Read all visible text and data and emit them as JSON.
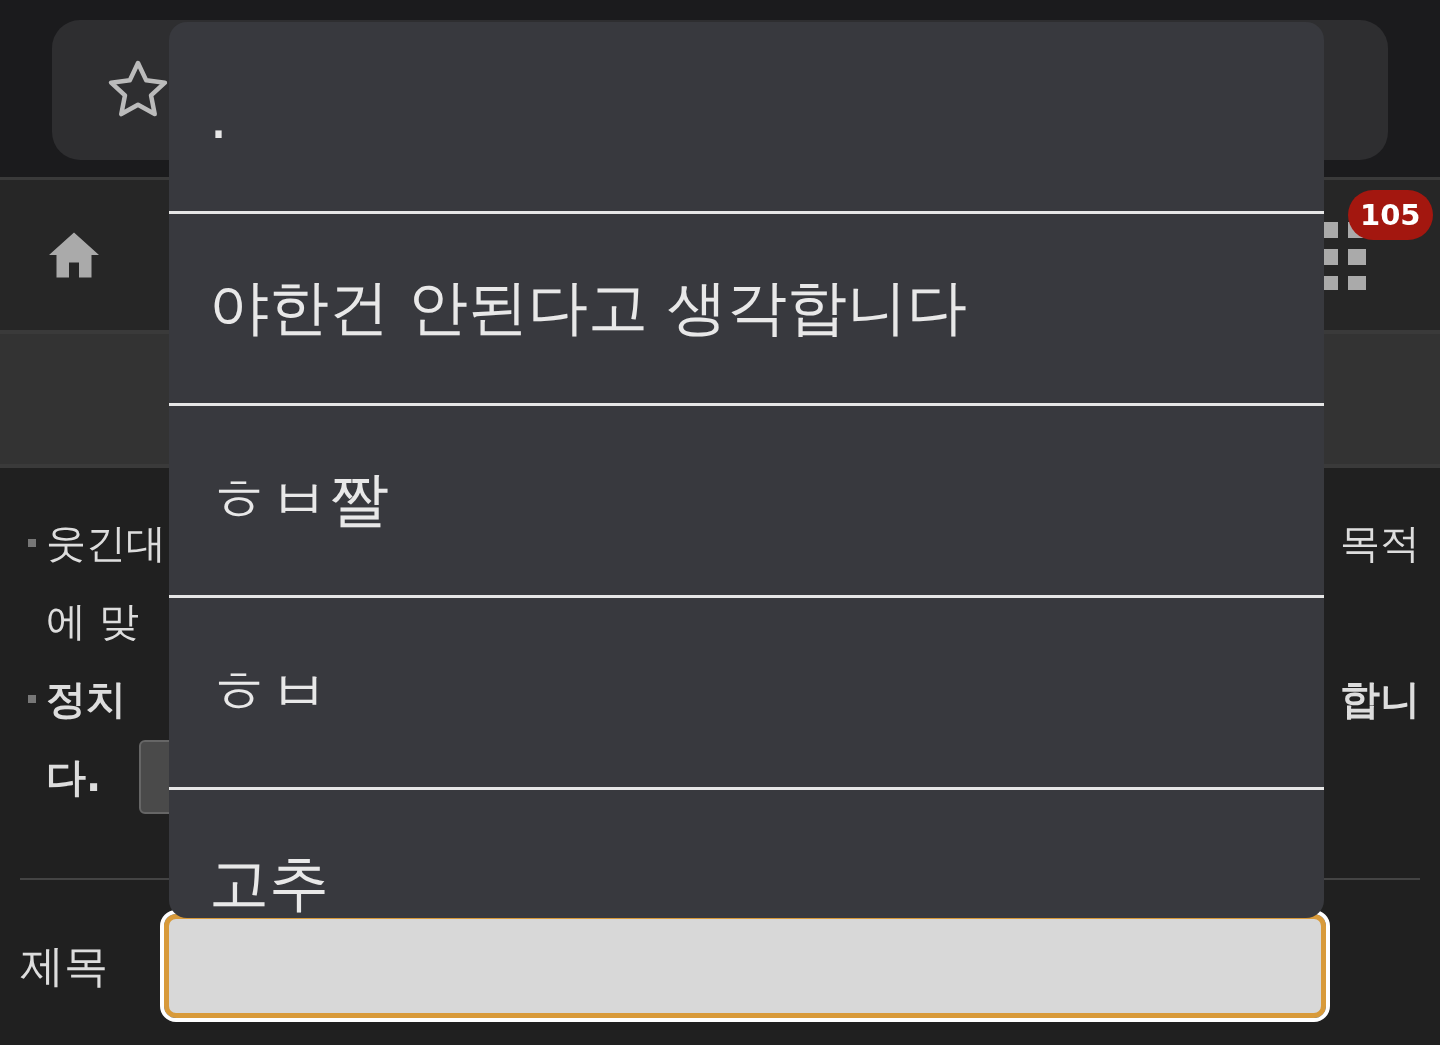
{
  "nav": {
    "badge": "105"
  },
  "notice": {
    "rows": [
      {
        "left": "웃긴대",
        "right": "목적",
        "bold": false,
        "bullet": true
      },
      {
        "left": "에 맞",
        "bold": false,
        "bullet": false
      },
      {
        "left": "정치 ",
        "right": "합니",
        "bold": true,
        "bullet": true
      },
      {
        "left": "다.",
        "bold": true,
        "bullet": false,
        "has_button": true
      }
    ]
  },
  "title_field": {
    "label": "제목",
    "focused": true
  },
  "suggestions": [
    {
      "text": "."
    },
    {
      "text": "야한건 안된다고 생각합니다"
    },
    {
      "text": "ㅎㅂ짤"
    },
    {
      "text": "ㅎㅂ"
    },
    {
      "text": "고추"
    }
  ]
}
